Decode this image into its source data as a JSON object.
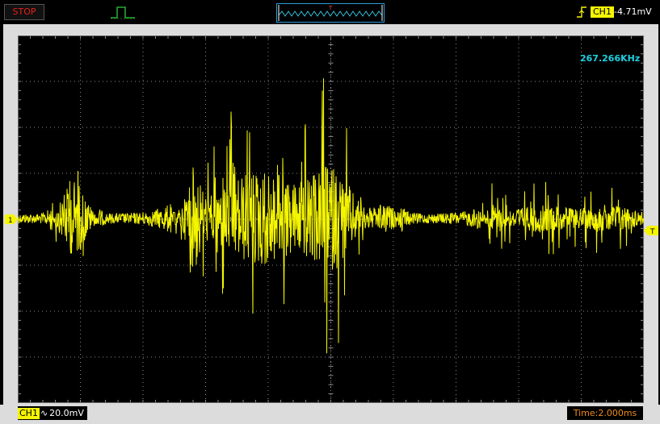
{
  "status": {
    "label": "STOP",
    "color": "#e8201a"
  },
  "trigger": {
    "icon": "rising-edge-icon",
    "channel": "CH1",
    "level": "-4.71mV"
  },
  "measure": {
    "frequency": "267.266KHz",
    "color": "#1fd0e0"
  },
  "channel_marker": "1",
  "trigger_marker": "T",
  "mini_marker": "T",
  "bottom": {
    "channel": "CH1",
    "coupling_icon": "ac-coupling-icon",
    "coupling_glyph": "∿",
    "volts_div": "20.0mV",
    "timebase": "Time:2.000ms"
  },
  "colors": {
    "trace": "#f5f500",
    "grid": "#8a8a8a",
    "panel": "#dcdcdc"
  }
}
